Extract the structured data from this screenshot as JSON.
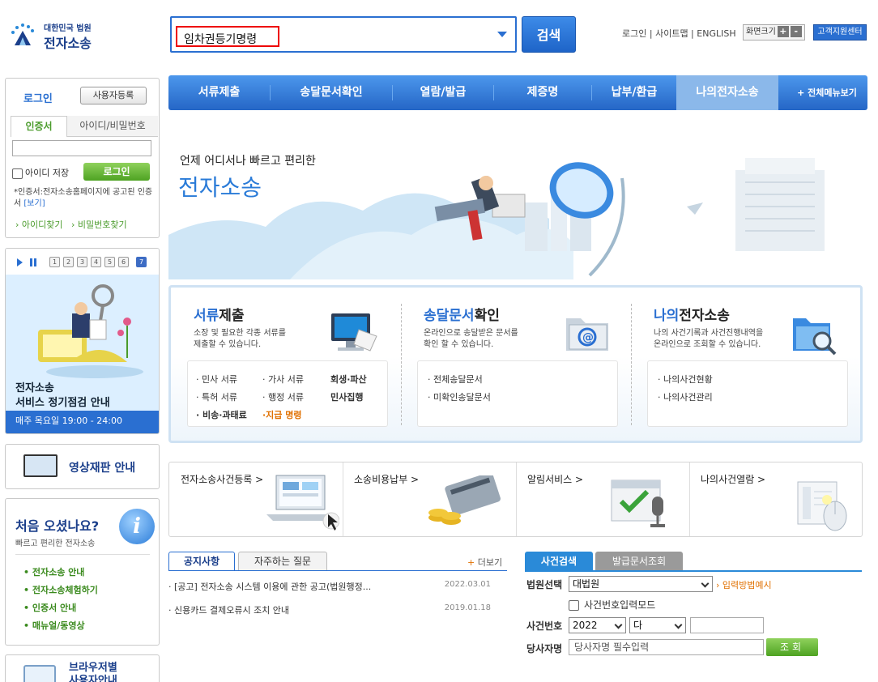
{
  "header": {
    "logo_top": "대한민국 법원",
    "logo_main": "전자소송",
    "search_value": "임차권등기명령",
    "search_button": "검색",
    "links": [
      "로그인",
      "사이트맵",
      "ENGLISH"
    ],
    "font_size_label": "화면크기",
    "font_plus": "+",
    "font_minus": "-",
    "support_center": "고객지원센터"
  },
  "nav": {
    "items": [
      "서류제출",
      "송달문서확인",
      "열람/발급",
      "제증명",
      "납부/환급",
      "나의전자소송"
    ],
    "all_menu": "+ 전체메뉴보기"
  },
  "login": {
    "title": "로그인",
    "register": "사용자등록",
    "tab_cert": "인증서",
    "tab_id": "아이디/비밀번호",
    "save_id": "아이디 저장",
    "login_button": "로그인",
    "note": "*인증서:전자소송홈페이지에 공고된 인증서",
    "note_link": "[보기]",
    "find_id": "› 아이디찾기",
    "find_pw": "› 비밀번호찾기"
  },
  "banner": {
    "pages": [
      "1",
      "2",
      "3",
      "4",
      "5",
      "6",
      "7"
    ],
    "active_page": "7",
    "caption_line1": "전자소송",
    "caption_line2": "서비스 정기점검 안내",
    "caption_time": "매주 목요일 19:00 - 24:00"
  },
  "video": {
    "label": "영상재판 안내"
  },
  "first_visit": {
    "title": "처음 오셨나요?",
    "subtitle": "빠르고 편리한 전자소송",
    "links": [
      "• 전자소송 안내",
      "• 전자소송체험하기",
      "• 인증서 안내",
      "• 매뉴얼/동영상"
    ]
  },
  "browser": {
    "line1": "브라우저별",
    "line2": "사용자안내"
  },
  "hero": {
    "sub": "언제 어디서나 빠르고 편리한",
    "title": "전자소송"
  },
  "services": [
    {
      "title_b": "서류",
      "title": "제출",
      "desc1": "소장 및 필요한 각종 서류를",
      "desc2": "제출할 수 있습니다.",
      "links": [
        "· 민사 서류",
        "· 가사 서류",
        "회생·파산",
        "· 특허 서류",
        "· 행정 서류",
        "민사집행",
        "· 비송·과태료",
        "·지급 명령"
      ]
    },
    {
      "title_b": "송달문서",
      "title": "확인",
      "desc1": "온라인으로 송달받은 문서를",
      "desc2": "확인 할 수 있습니다.",
      "links": [
        "· 전체송달문서",
        "· 미확인송달문서"
      ]
    },
    {
      "title_b": "나의",
      "title": "전자소송",
      "desc1": "나의 사건기록과 사건진행내역을",
      "desc2": "온라인으로 조회할 수 있습니다.",
      "links": [
        "· 나의사건현황",
        "· 나의사건관리"
      ]
    }
  ],
  "quick": [
    "전자소송사건등록 >",
    "소송비용납부 >",
    "알림서비스 >",
    "나의사건열람 >"
  ],
  "notice": {
    "tab1": "공지사항",
    "tab2": "자주하는 질문",
    "more": "더보기",
    "rows": [
      {
        "title": "· [공고] 전자소송 시스템 이용에 관한 공고(법원행정...",
        "date": "2022.03.01"
      },
      {
        "title": "· 신용카드 결제오류시 조치 안내",
        "date": "2019.01.18"
      }
    ]
  },
  "case_search": {
    "tab1": "사건검색",
    "tab2": "발급문서조회",
    "court_label": "법원선택",
    "court_value": "대법원",
    "input_help": "› 입력방법예시",
    "mode_label": "사건번호입력모드",
    "case_label": "사건번호",
    "year": "2022",
    "type": "다",
    "party_label": "당사자명",
    "party_placeholder": "당사자명 필수입력",
    "search_button": "조회"
  },
  "colors": {
    "brand_blue": "#2a6fd1",
    "green": "#4ea322",
    "orange": "#e07000"
  }
}
